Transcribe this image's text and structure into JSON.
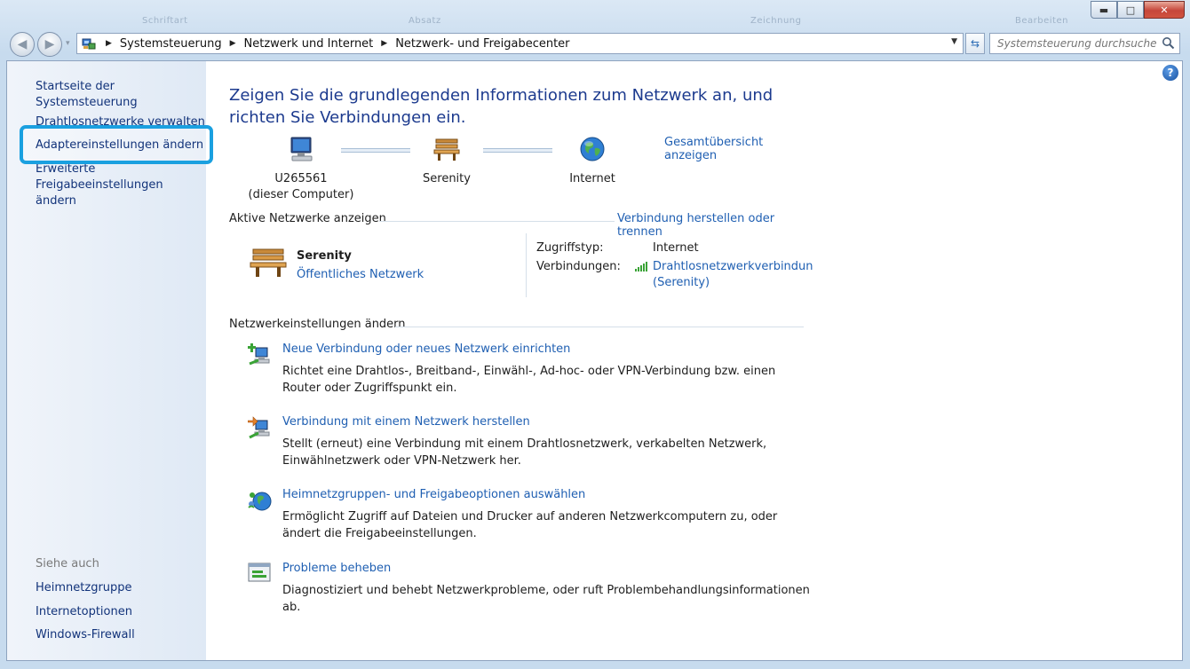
{
  "window": {
    "controls": {
      "minimize": "▬",
      "maximize": "□",
      "close": "✕"
    },
    "ghost_menu": [
      "Schriftart",
      "Absatz",
      "Zeichnung",
      "Bearbeiten"
    ]
  },
  "toolbar": {
    "back": "◀",
    "forward": "▶",
    "history": "▾",
    "breadcrumb": [
      "Systemsteuerung",
      "Netzwerk und Internet",
      "Netzwerk- und Freigabecenter"
    ],
    "breadcrumb_sep": "▶",
    "address_dropdown": "▼",
    "refresh": "⇆",
    "search_placeholder": "Systemsteuerung durchsuchen"
  },
  "sidebar": {
    "items": [
      {
        "label": "Startseite der Systemsteuerung"
      },
      {
        "label": "Drahtlosnetzwerke verwalten"
      },
      {
        "label": "Adaptereinstellungen ändern"
      },
      {
        "label": "Erweiterte Freigabeeinstellungen ändern"
      }
    ],
    "see_also_title": "Siehe auch",
    "see_also": [
      {
        "label": "Heimnetzgruppe"
      },
      {
        "label": "Internetoptionen"
      },
      {
        "label": "Windows-Firewall"
      }
    ]
  },
  "help": "?",
  "main": {
    "title": "Zeigen Sie die grundlegenden Informationen zum Netzwerk an, und richten Sie Verbindungen ein.",
    "overview_link": "Gesamtübersicht anzeigen",
    "map": {
      "computer": {
        "name": "U265561",
        "sub": "(dieser Computer)"
      },
      "network": {
        "name": "Serenity"
      },
      "internet": {
        "name": "Internet"
      }
    },
    "active_networks": {
      "heading": "Aktive Netzwerke anzeigen",
      "action_link": "Verbindung herstellen oder trennen",
      "network_name": "Serenity",
      "network_type": "Öffentliches Netzwerk",
      "access_type_label": "Zugriffstyp:",
      "access_type_value": "Internet",
      "connections_label": "Verbindungen:",
      "connection_link_line1": "Drahtlosnetzwerkverbindun",
      "connection_link_line2": "(Serenity)"
    },
    "settings": {
      "heading": "Netzwerkeinstellungen ändern",
      "tasks": [
        {
          "title": "Neue Verbindung oder neues Netzwerk einrichten",
          "desc": "Richtet eine Drahtlos-, Breitband-, Einwähl-, Ad-hoc- oder VPN-Verbindung bzw. einen Router oder Zugriffspunkt ein."
        },
        {
          "title": "Verbindung mit einem Netzwerk herstellen",
          "desc": "Stellt (erneut) eine Verbindung mit einem Drahtlosnetzwerk, verkabelten Netzwerk, Einwählnetzwerk oder VPN-Netzwerk her."
        },
        {
          "title": "Heimnetzgruppen- und Freigabeoptionen auswählen",
          "desc": "Ermöglicht Zugriff auf Dateien und Drucker auf anderen Netzwerkcomputern zu, oder ändert die Freigabeeinstellungen."
        },
        {
          "title": "Probleme beheben",
          "desc": "Diagnostiziert und behebt Netzwerkprobleme, oder ruft Problembehandlungsinformationen ab."
        }
      ]
    }
  },
  "colors": {
    "link": "#1f5fb2",
    "title": "#1c3a8e",
    "highlight": "#1aa0e0",
    "sidebar": "#dfe9f5"
  }
}
